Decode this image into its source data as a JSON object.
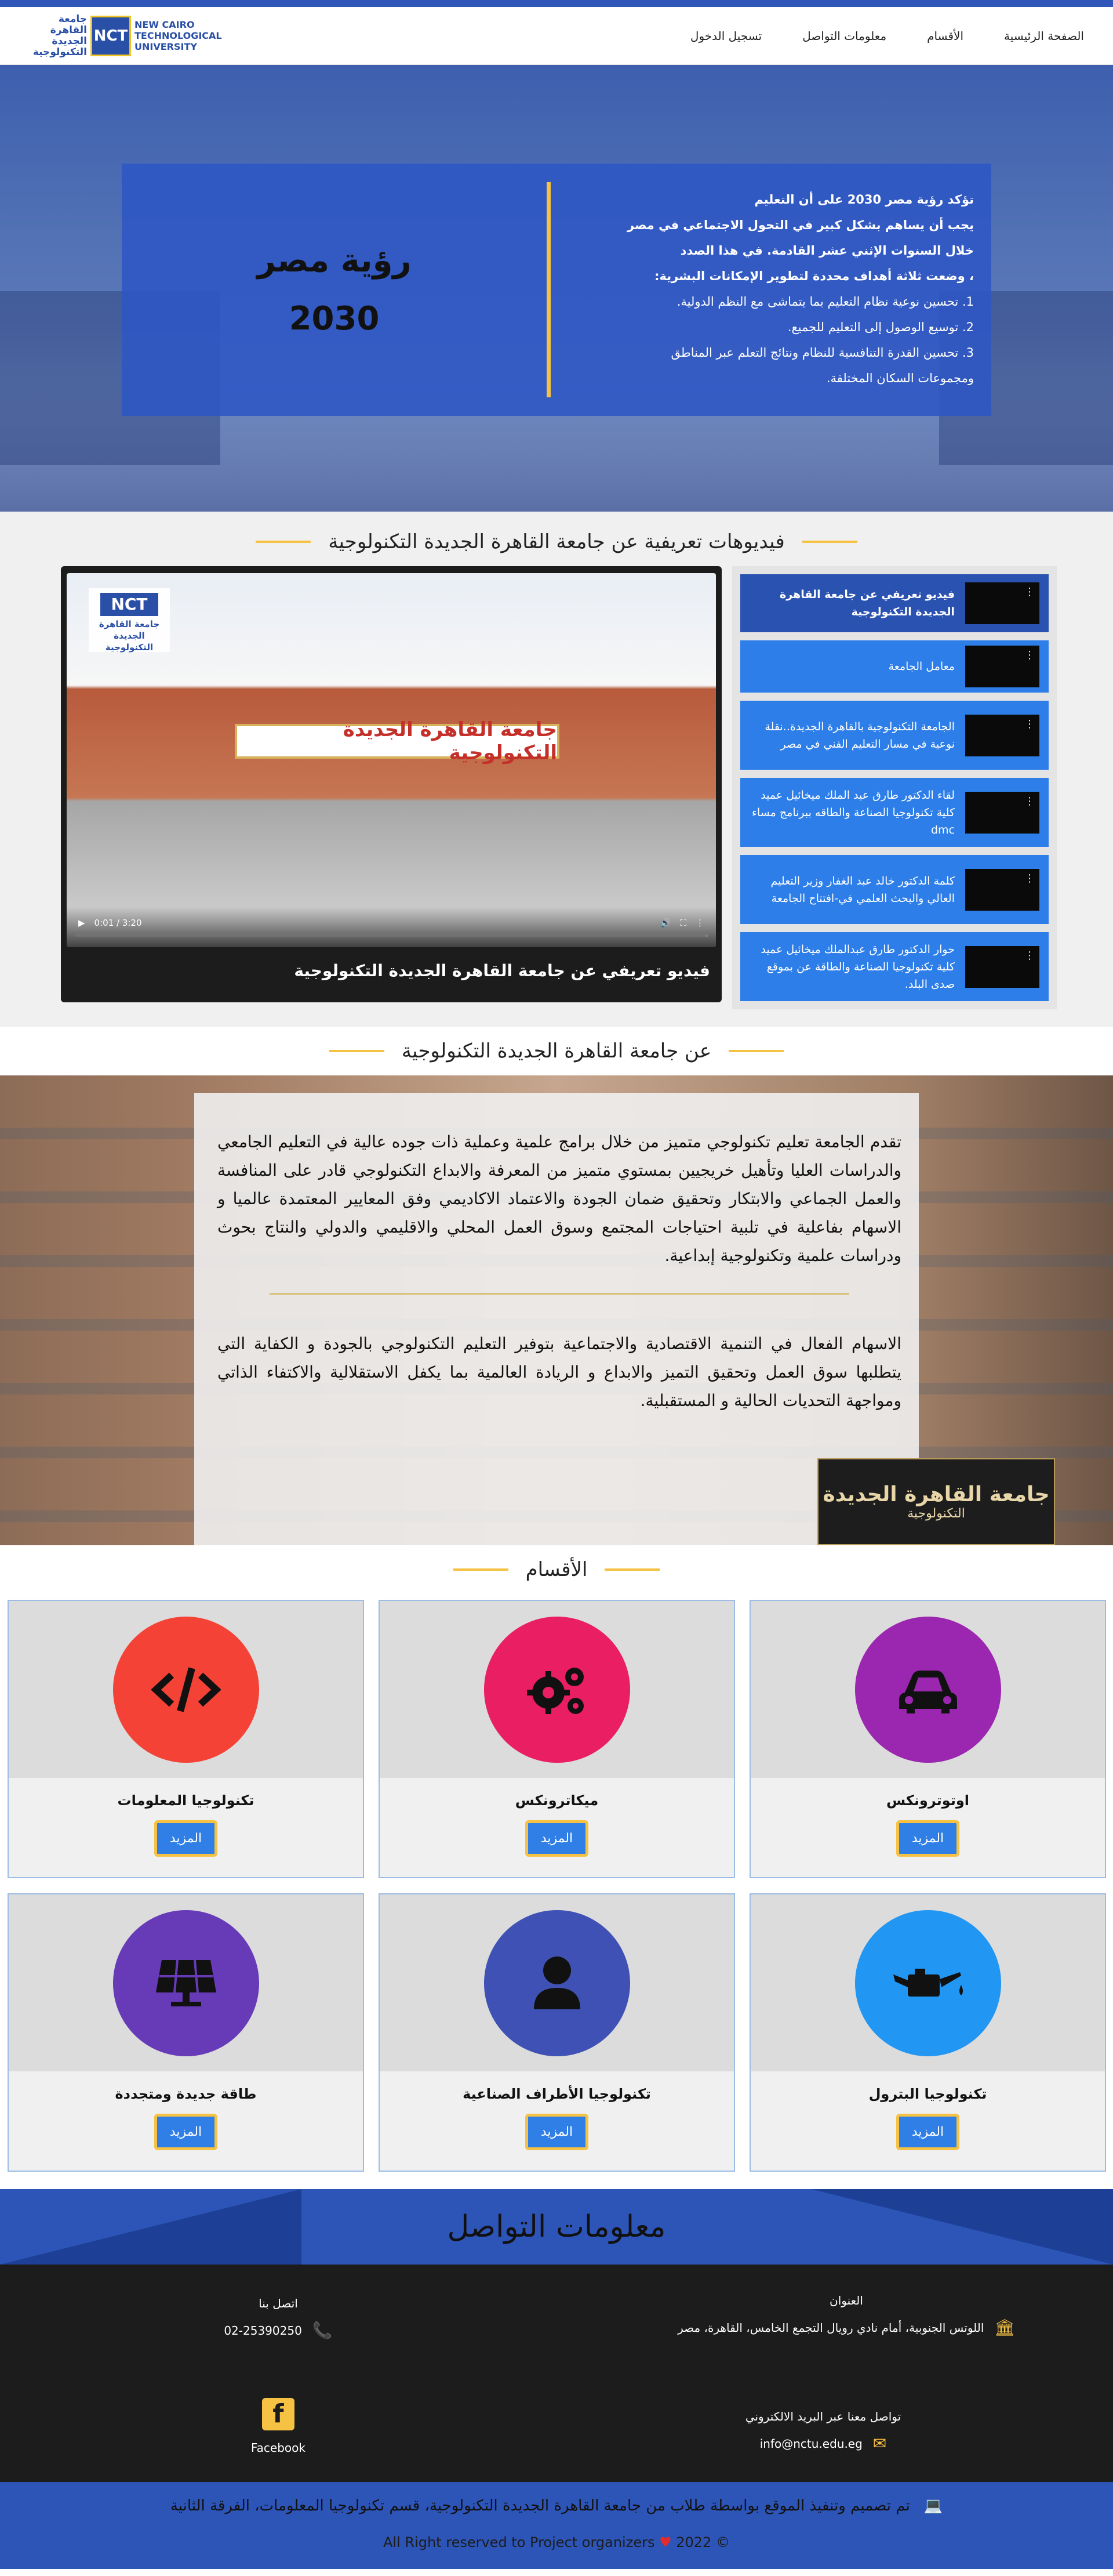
{
  "nav": {
    "links": [
      "الصفحة الرئيسية",
      "الأقسام",
      "معلومات التواصل",
      "تسجيل الدخول"
    ],
    "logo": {
      "ar_line1": "جامعة",
      "ar_line2": "القاهرة الجديدة",
      "ar_line3": "التكنولوجية",
      "mark": "NCT",
      "en_line1": "NEW CAIRO",
      "en_line2": "TECHNOLOGICAL",
      "en_line3": "UNIVERSITY"
    }
  },
  "hero": {
    "title_line1": "رؤية مصر",
    "title_line2": "2030",
    "lines": [
      "تؤكد رؤية مصر 2030 على أن التعليم",
      "يجب أن يساهم بشكل كبير في التحول الاجتماعي في مصر",
      "خلال السنوات الإثني عشر القادمة. في هذا الصدد",
      "، وضعت ثلاثة أهداف محددة لتطوير الإمكانات البشرية:",
      "1. تحسين نوعية نظام التعليم بما يتماشى مع النظم الدولية.",
      "2. توسيع الوصول إلى التعليم للجميع.",
      "3. تحسين القدرة التنافسية للنظام ونتائج التعلم عبر المناطق",
      "ومجموعات السكان المختلفة."
    ]
  },
  "videos": {
    "section_title": "فيديوهات تعريفية عن جامعة القاهرة الجديدة التكنولوجية",
    "playlist": [
      "فيديو تعريفي عن جامعة القاهرة الجديدة التكنولوجية",
      "معامل الجامعة",
      "الجامعة التكنولوجية بالقاهرة الجديدة..نقلة نوعية في مسار التعليم الفني في مصر",
      "لقاء الدكتور طارق عبد الملك ميخائيل عميد كلية تكنولوجيا الصناعة والطاقه ببرنامج مساء dmc",
      "كلمة الدكتور خالد عبد الغفار وزير التعليم العالي والبحث العلمي في-افتتاح الجامعة",
      "حوار الدكتور طارق عبدالملك ميخائيل عميد كلية تكنولوجيا الصناعة والطاقة عن بموقع صدى البلد."
    ],
    "player": {
      "caption": "فيديو تعريفي عن جامعة القاهرة الجديدة التكنولوجية",
      "time": "0:01 / 3:20",
      "progress": 0.005,
      "sign_text": "جامعة القاهرة الجديدة التكنولوجية",
      "overlay_logo_mark": "NCT",
      "overlay_logo_text": "جامعة القاهرة الجديدة التكنولوجية"
    }
  },
  "about": {
    "section_title": "عن جامعة القاهرة الجديدة التكنولوجية",
    "p1": "تقدم الجامعة تعليم تكنولوجي متميز من خلال برامج علمية وعملية ذات جوده عالية في التعليم الجامعي والدراسات العليا وتأهيل خريجيين بمستوي متميز من المعرفة والابداع التكنولوجي قادر على المنافسة والعمل الجماعي والابتكار وتحقيق ضمان الجودة والاعتماد الاكاديمي وفق المعايير المعتمدة عالميا و الاسهام بفاعلية في تلبية احتياجات المجتمع وسوق العمل المحلي والاقليمي والدولي والنتاج بحوث ودراسات علمية وتكنولوجية إبداعية.",
    "p2": "الاسهام الفعال في التنمية الاقتصادية والاجتماعية بتوفير التعليم التكنولوجي بالجودة و الكفاية التي يتطلبها سوق العمل وتحقيق التميز والابداع و الريادة العالمية بما يكفل الاستقلالية والاكتفاء الذاتي ومواجهة التحديات الحالية و المستقبلية.",
    "badge_line1": "جامعة القاهرة الجديدة",
    "badge_line2": "التكنولوجية"
  },
  "departments": {
    "section_title": "الأقسام",
    "more_label": "المزيد",
    "items": [
      {
        "name": "اوتوترونكس",
        "icon": "car-icon",
        "color": "#9b27b0"
      },
      {
        "name": "ميكاترونكس",
        "icon": "gears-icon",
        "color": "#e91e63"
      },
      {
        "name": "تكنولوجيا المعلومات",
        "icon": "code-icon",
        "color": "#f44336"
      },
      {
        "name": "تكنولوجيا البترول",
        "icon": "oil-can-icon",
        "color": "#2196f3"
      },
      {
        "name": "تكنولوجيا الأطراف الصناعية",
        "icon": "user-icon",
        "color": "#3f51b5"
      },
      {
        "name": "طاقة جديدة ومتجددة",
        "icon": "solar-panel-icon",
        "color": "#673ab7"
      }
    ]
  },
  "contact": {
    "title": "معلومات التواصل",
    "address_label": "العنوان",
    "address": "اللوتس الجنوبية، أمام نادي رويال التجمع الخامس، القاهرة، مصر",
    "phone_label": "اتصل بنا",
    "phone": "02-25390250",
    "email_label": "تواصل معنا عبر البريد الالكتروني",
    "email": "info@nctu.edu.eg",
    "facebook_label": "Facebook"
  },
  "footer": {
    "credit": "تم تصميم وتنفيذ الموقع بواسطة طلاب من جامعة القاهرة الجديدة التكنولوجية، قسم تكنولوجيا المعلومات، الفرقة الثانية",
    "rights_before": "All Right reserved to Project organizers",
    "rights_after": "2022 ©"
  }
}
